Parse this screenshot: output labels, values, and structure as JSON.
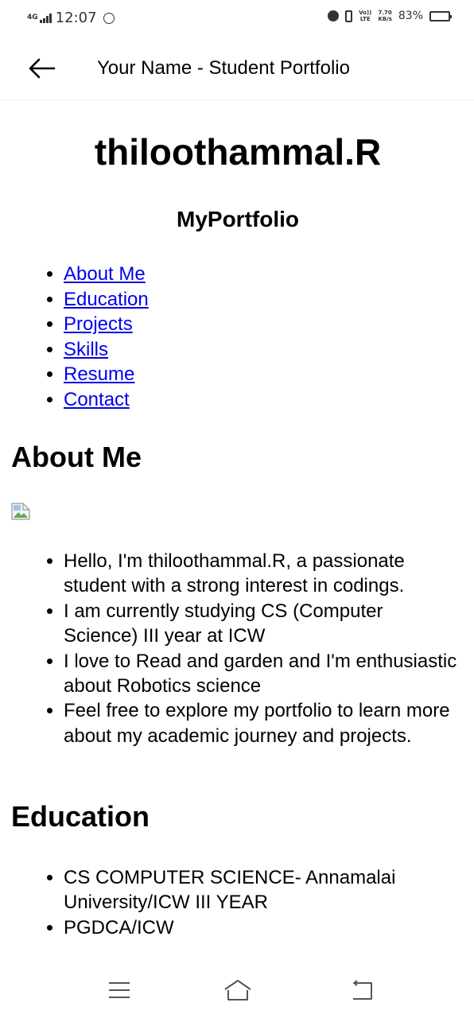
{
  "status_bar": {
    "network": "4G",
    "time": "12:07",
    "lte_top": "Vo))",
    "lte_bottom": "LTE",
    "speed_top": "7.70",
    "speed_bottom": "KB/s",
    "battery": "83%"
  },
  "app_bar": {
    "title": "Your Name - Student Portfolio"
  },
  "header": {
    "name": "thiloothammal.R",
    "brand": "MyPortfolio"
  },
  "nav": {
    "items": [
      {
        "label": "About Me"
      },
      {
        "label": "Education"
      },
      {
        "label": "Projects"
      },
      {
        "label": "Skills"
      },
      {
        "label": "Resume"
      },
      {
        "label": "Contact"
      }
    ]
  },
  "about": {
    "heading": "About Me",
    "items": [
      "Hello, I'm thiloothammal.R, a passionate student with a strong interest in codings.",
      "I am currently studying CS (Computer Science) III year at ICW",
      "I love to Read and garden and I'm enthusiastic about Robotics science",
      "Feel free to explore my portfolio to learn more about my academic journey and projects."
    ]
  },
  "education": {
    "heading": "Education",
    "items": [
      "CS COMPUTER SCIENCE- Annamalai University/ICW III YEAR",
      "PGDCA/ICW"
    ]
  },
  "colors": {
    "link": "#0000ee",
    "text": "#000000",
    "status_icons": "#333333"
  }
}
